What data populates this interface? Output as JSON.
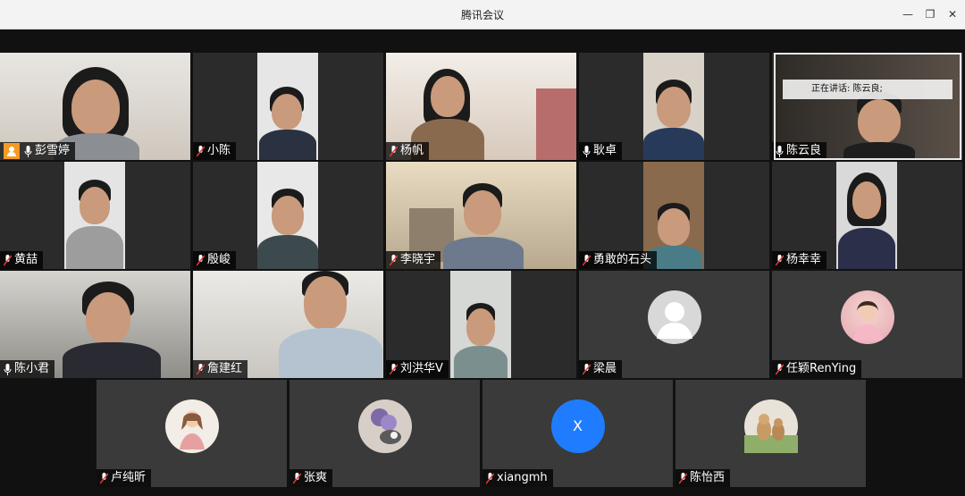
{
  "window": {
    "title": "腾讯会议"
  },
  "speaking": {
    "label": "正在讲话: 陈云良;"
  },
  "participants": [
    {
      "name": "彭雪婷",
      "host": true
    },
    {
      "name": "小陈"
    },
    {
      "name": "杨帆"
    },
    {
      "name": "耿卓"
    },
    {
      "name": "陈云良"
    },
    {
      "name": "黄喆"
    },
    {
      "name": "殷峻"
    },
    {
      "name": "李晓宇"
    },
    {
      "name": "勇敢的石头"
    },
    {
      "name": "杨幸幸"
    },
    {
      "name": "陈小君"
    },
    {
      "name": "詹建红"
    },
    {
      "name": "刘洪华V"
    },
    {
      "name": "梁晨"
    },
    {
      "name": "任颖RenYing"
    },
    {
      "name": "卢纯昕"
    },
    {
      "name": "张爽"
    },
    {
      "name": "xiangmh",
      "avatar_letter": "X"
    },
    {
      "name": "陈怡西"
    }
  ]
}
